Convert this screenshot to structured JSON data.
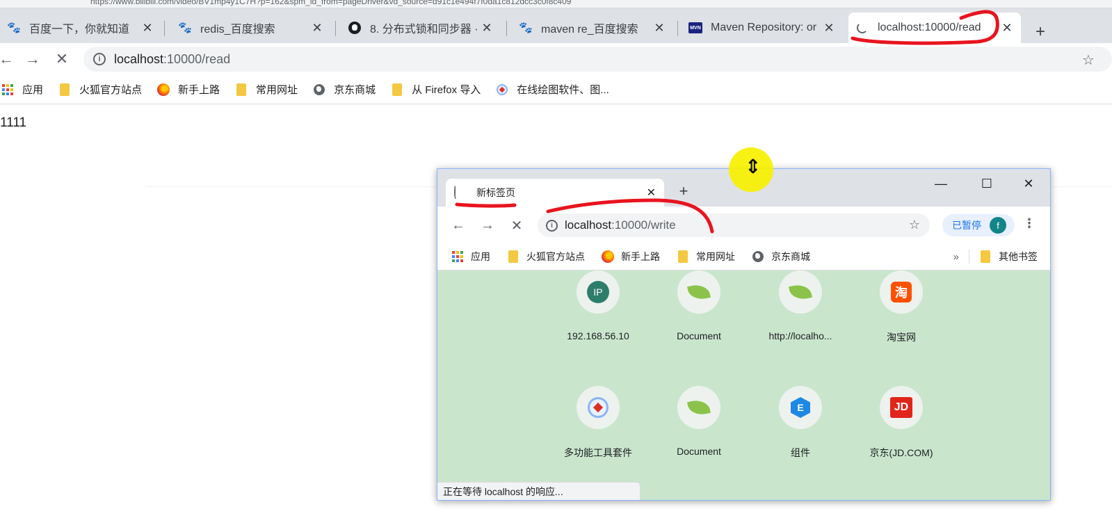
{
  "top_strip": {
    "url_fragment": "https://www.bilibili.com/video/BV1mp4y1C7H?p=162&spm_id_from=pageDriver&vd_source=d91c1e494f7f0da1c812dcc3c0f8c409"
  },
  "tabs": [
    {
      "label": "百度一下，你就知道",
      "icon": "baidu-paw-icon",
      "close": "✕"
    },
    {
      "label": "redis_百度搜索",
      "icon": "baidu-paw-icon",
      "close": "✕"
    },
    {
      "label": "8. 分布式锁和同步器 · r",
      "icon": "github-icon",
      "close": "✕"
    },
    {
      "label": "maven re_百度搜索",
      "icon": "baidu-paw-icon",
      "close": "✕"
    },
    {
      "label": "Maven Repository: or",
      "icon": "mvn-icon",
      "close": "✕"
    },
    {
      "label": "localhost:10000/read",
      "icon": "loading-spinner-icon",
      "close": "✕"
    }
  ],
  "new_tab_symbol": "+",
  "toolbar": {
    "back": "←",
    "forward": "→",
    "stop": "✕",
    "info_symbol": "i",
    "url_host": "localhost",
    "url_path": ":10000/read",
    "star": "☆"
  },
  "bookmarks": [
    {
      "label": "应用",
      "icon": "apps-grid-icon"
    },
    {
      "label": "火狐官方站点",
      "icon": "folder-icon"
    },
    {
      "label": "新手上路",
      "icon": "firefox-icon"
    },
    {
      "label": "常用网址",
      "icon": "folder-icon"
    },
    {
      "label": "京东商城",
      "icon": "globe-icon"
    },
    {
      "label": "从 Firefox 导入",
      "icon": "folder-icon"
    },
    {
      "label": "在线绘图软件、图...",
      "icon": "drawio-icon"
    }
  ],
  "page": {
    "text": "1111"
  },
  "cursor": {
    "symbol": "⇕",
    "highlight_color": "#f7f000"
  },
  "popup": {
    "tab_label": "新标签页",
    "tab_close": "✕",
    "new_tab_symbol": "+",
    "window_controls": {
      "minimize": "—",
      "maximize": "☐",
      "close": "✕"
    },
    "toolbar": {
      "back": "←",
      "forward": "→",
      "stop": "✕",
      "info_symbol": "i",
      "url_host": "localhost",
      "url_path": ":10000/write",
      "star": "☆",
      "paused_label": "已暂停",
      "avatar_letter": "f",
      "menu": "⋮"
    },
    "bookmarks": [
      {
        "label": "应用",
        "icon": "apps-grid-icon"
      },
      {
        "label": "火狐官方站点",
        "icon": "folder-icon"
      },
      {
        "label": "新手上路",
        "icon": "firefox-icon"
      },
      {
        "label": "常用网址",
        "icon": "folder-icon"
      },
      {
        "label": "京东商城",
        "icon": "globe-icon"
      }
    ],
    "bookmarks_overflow": "»",
    "other_bookmarks": "其他书签",
    "shortcuts": [
      {
        "label": "192.168.56.10",
        "icon": "ip-icon",
        "icon_text": "IP"
      },
      {
        "label": "Document",
        "icon": "spring-leaf-icon",
        "icon_text": ""
      },
      {
        "label": "http://localho...",
        "icon": "spring-leaf-icon",
        "icon_text": ""
      },
      {
        "label": "淘宝网",
        "icon": "taobao-icon",
        "icon_text": "淘"
      },
      {
        "label": "多功能工具套件",
        "icon": "multitool-icon",
        "icon_text": ""
      },
      {
        "label": "Document",
        "icon": "spring-leaf-icon",
        "icon_text": ""
      },
      {
        "label": "组件",
        "icon": "component-icon",
        "icon_text": "E"
      },
      {
        "label": "京东(JD.COM)",
        "icon": "jd-icon",
        "icon_text": "JD"
      }
    ],
    "status": "正在等待 localhost 的响应..."
  },
  "colors": {
    "tabbar": "#dee1e6",
    "new_tab_page_bg": "#c9e6cd",
    "annotation_red": "#e8141e",
    "link_blue": "#1a73e8"
  }
}
